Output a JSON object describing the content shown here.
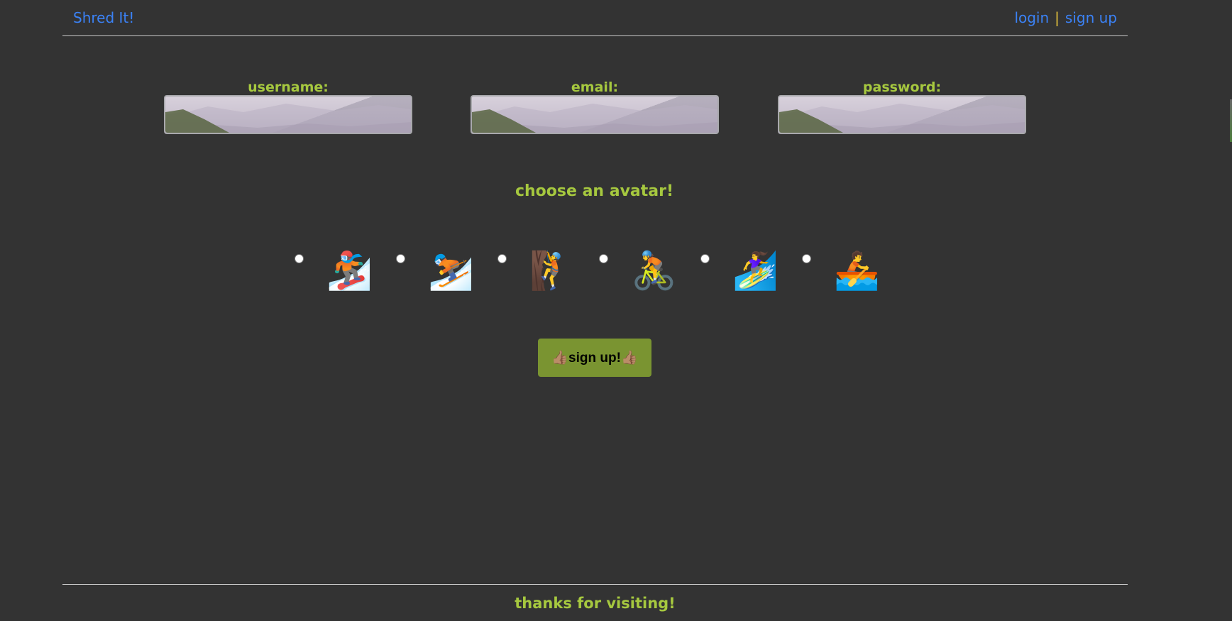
{
  "header": {
    "brand": "Shred It!",
    "login_label": "login",
    "separator": "|",
    "signup_label": "sign up"
  },
  "form": {
    "username_label": "username:",
    "email_label": "email:",
    "password_label": "password:",
    "username_value": "",
    "email_value": "",
    "password_value": ""
  },
  "avatar_section": {
    "heading": "choose an avatar!",
    "options": [
      {
        "icon": "snowboarder-icon",
        "glyph": "🏂",
        "selected": false
      },
      {
        "icon": "skier-icon",
        "glyph": "⛷️",
        "selected": false
      },
      {
        "icon": "climber-icon",
        "glyph": "🧗",
        "selected": false
      },
      {
        "icon": "cyclist-icon",
        "glyph": "🚴",
        "selected": false
      },
      {
        "icon": "surfer-icon",
        "glyph": "🏄‍♀️",
        "selected": false
      },
      {
        "icon": "rowboat-icon",
        "glyph": "🚣",
        "selected": false
      }
    ]
  },
  "submit": {
    "label": "sign up!",
    "thumb": "👍🏽"
  },
  "footer": {
    "text": "thanks for visiting!"
  },
  "colors": {
    "background": "#333333",
    "accent_green": "#a6c83f",
    "link_blue": "#3b82f6",
    "button_green": "#7a9431",
    "separator_yellow": "#e6c33c"
  }
}
